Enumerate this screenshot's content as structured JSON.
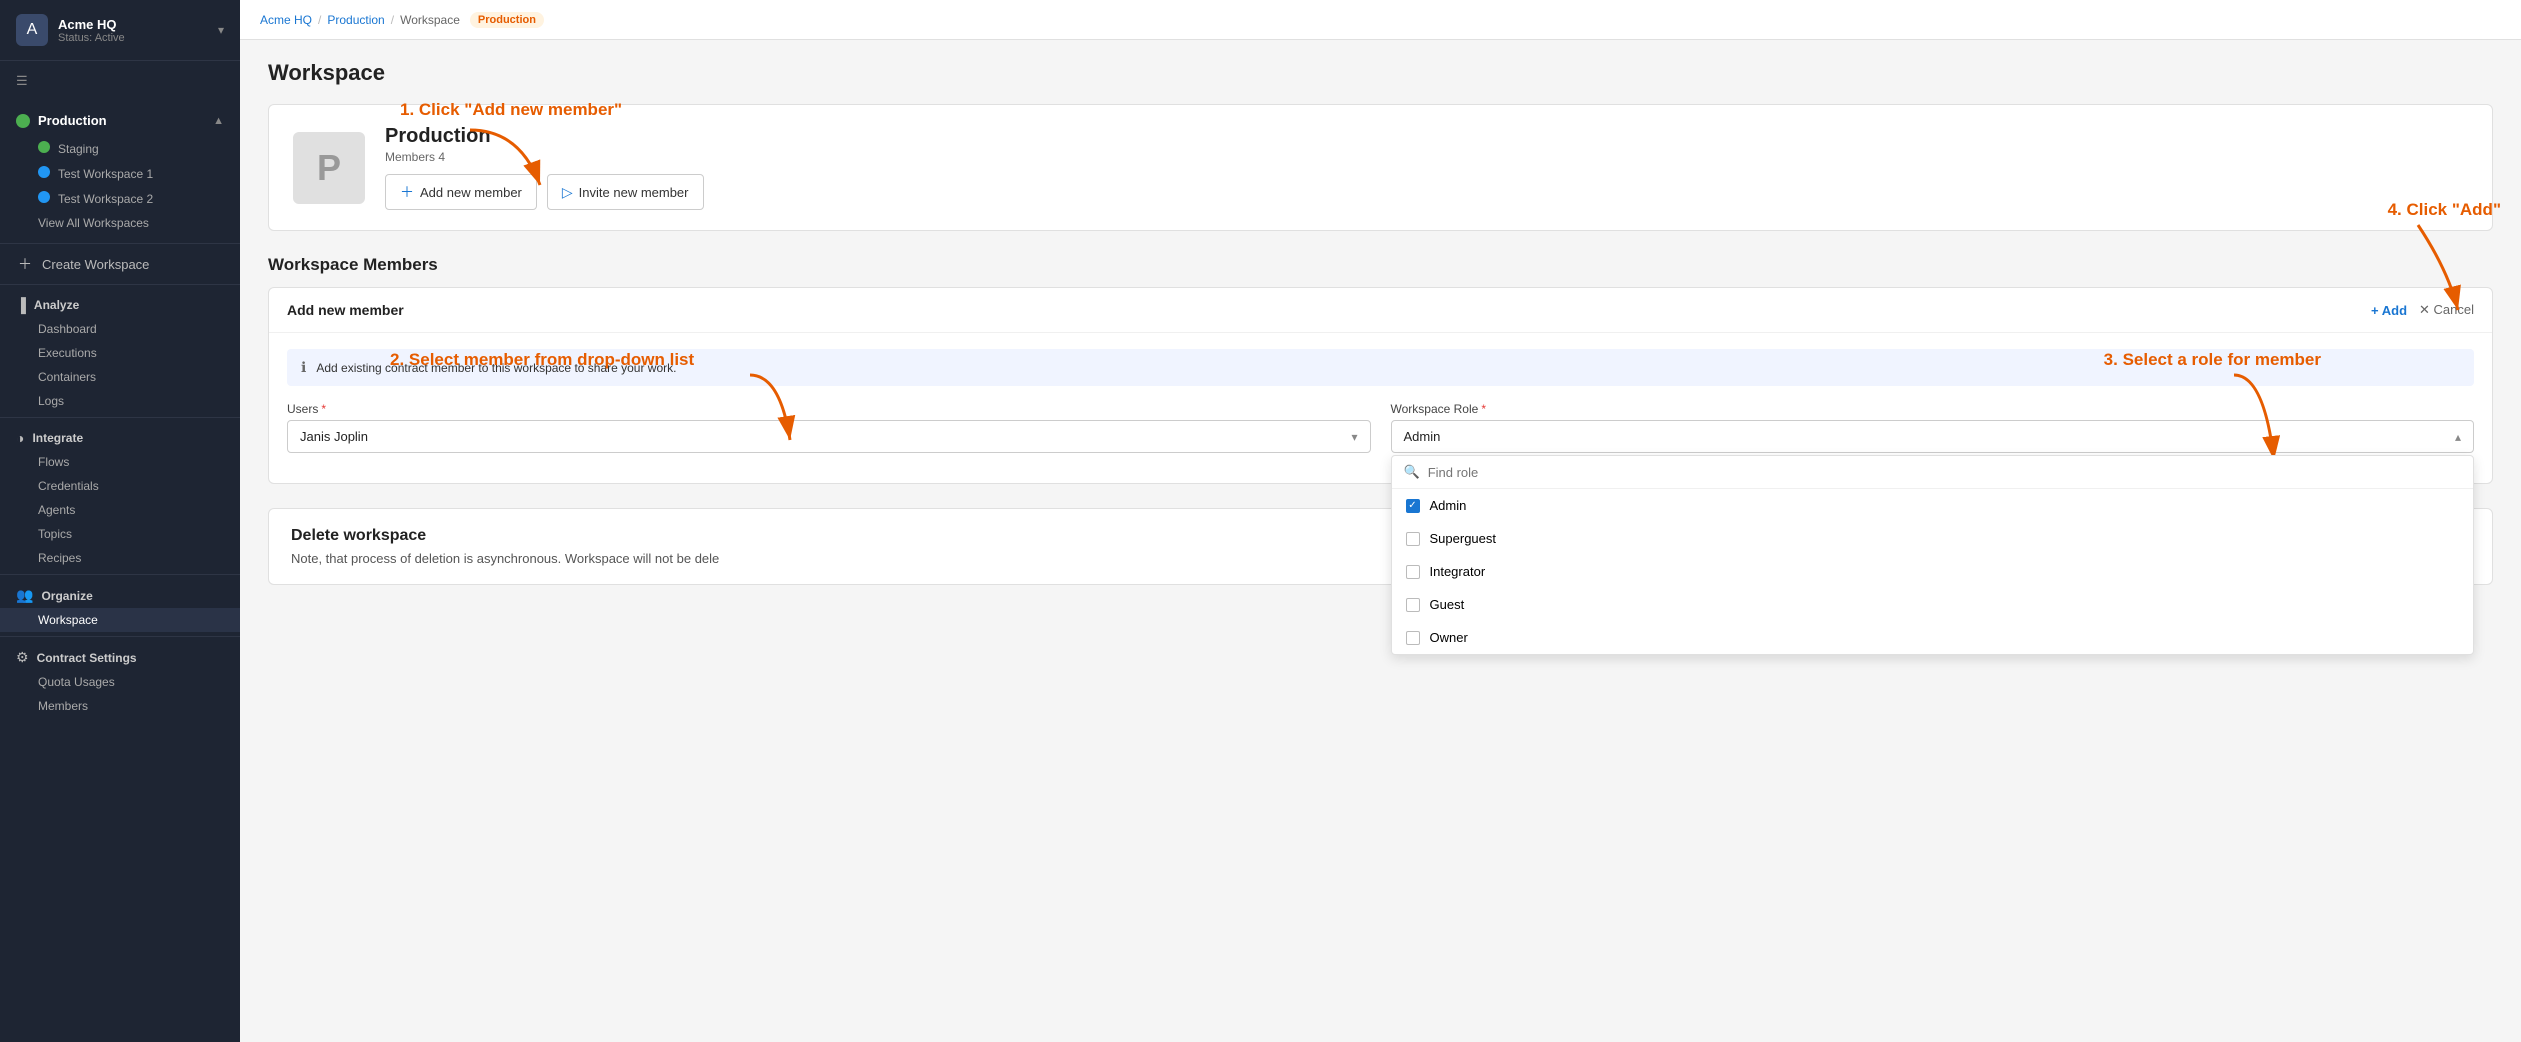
{
  "sidebar": {
    "logo_letter": "A",
    "org_name": "Acme HQ",
    "org_status": "Status: Active",
    "production_label": "Production",
    "items": [
      {
        "id": "staging",
        "label": "Staging",
        "color": "green"
      },
      {
        "id": "test-ws-1",
        "label": "Test Workspace 1",
        "color": "blue"
      },
      {
        "id": "test-ws-2",
        "label": "Test Workspace 2",
        "color": "blue"
      },
      {
        "id": "view-all",
        "label": "View All Workspaces"
      }
    ],
    "create_workspace": "Create Workspace",
    "analyze": {
      "label": "Analyze",
      "items": [
        "Dashboard",
        "Executions",
        "Containers",
        "Logs"
      ]
    },
    "integrate": {
      "label": "Integrate",
      "items": [
        "Flows",
        "Credentials",
        "Agents",
        "Topics",
        "Recipes"
      ]
    },
    "organize": {
      "label": "Organize",
      "items": [
        "Workspace"
      ]
    },
    "contract_settings": {
      "label": "Contract Settings",
      "items": [
        "Quota Usages",
        "Members"
      ]
    }
  },
  "breadcrumb": {
    "items": [
      "Acme HQ",
      "Production",
      "Workspace"
    ]
  },
  "page_title": "Workspace",
  "workspace_card": {
    "avatar_letter": "P",
    "name": "Production",
    "members_label": "Members 4",
    "btn_add_member": "Add new member",
    "btn_invite_member": "Invite new member"
  },
  "members_section": {
    "title": "Workspace Members",
    "panel_title": "Add new member",
    "btn_add": "+ Add",
    "btn_cancel": "✕ Cancel",
    "info_text": "Add existing contract member to this workspace to share your work.",
    "users_label": "Users",
    "role_label": "Workspace Role",
    "selected_user": "Janis Joplin",
    "selected_role": "Admin",
    "role_search_placeholder": "Find role",
    "roles": [
      {
        "id": "admin",
        "label": "Admin",
        "checked": true
      },
      {
        "id": "superguest",
        "label": "Superguest",
        "checked": false
      },
      {
        "id": "integrator",
        "label": "Integrator",
        "checked": false
      },
      {
        "id": "guest",
        "label": "Guest",
        "checked": false
      },
      {
        "id": "owner",
        "label": "Owner",
        "checked": false
      }
    ]
  },
  "delete_section": {
    "title": "Delete workspace",
    "description": "Note, that process of deletion is asynchronous. Workspace will not be dele"
  },
  "env_badge": "Production",
  "annotations": {
    "step1": "1. Click \"Add new member\"",
    "step2": "2. Select member from drop-down list",
    "step3": "3. Select a role for member",
    "step4": "4. Click \"Add\""
  }
}
